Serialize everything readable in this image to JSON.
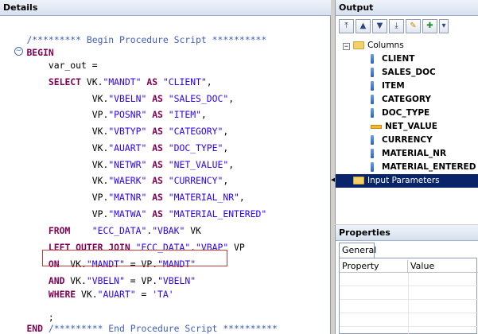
{
  "details": {
    "title": "Details",
    "code_lines": [
      [
        {
          "t": "    ",
          "c": "pl"
        },
        {
          "t": "/********* Begin Procedure Script **********",
          "c": "cm"
        }
      ],
      [
        {
          "t": "    ",
          "c": "pl"
        },
        {
          "t": "BEGIN",
          "c": "kw"
        }
      ],
      [
        {
          "t": "        var_out =",
          "c": "pl"
        }
      ],
      [
        {
          "t": "        ",
          "c": "pl"
        },
        {
          "t": "SELECT",
          "c": "kw"
        },
        {
          "t": " VK.",
          "c": "pl"
        },
        {
          "t": "\"MANDT\"",
          "c": "str"
        },
        {
          "t": " ",
          "c": "pl"
        },
        {
          "t": "AS",
          "c": "kw"
        },
        {
          "t": " ",
          "c": "pl"
        },
        {
          "t": "\"CLIENT\"",
          "c": "str"
        },
        {
          "t": ",",
          "c": "pl"
        }
      ],
      [
        {
          "t": "                VK.",
          "c": "pl"
        },
        {
          "t": "\"VBELN\"",
          "c": "str"
        },
        {
          "t": " ",
          "c": "pl"
        },
        {
          "t": "AS",
          "c": "kw"
        },
        {
          "t": " ",
          "c": "pl"
        },
        {
          "t": "\"SALES_DOC\"",
          "c": "str"
        },
        {
          "t": ",",
          "c": "pl"
        }
      ],
      [
        {
          "t": "                VP.",
          "c": "pl"
        },
        {
          "t": "\"POSNR\"",
          "c": "str"
        },
        {
          "t": " ",
          "c": "pl"
        },
        {
          "t": "AS",
          "c": "kw"
        },
        {
          "t": " ",
          "c": "pl"
        },
        {
          "t": "\"ITEM\"",
          "c": "str"
        },
        {
          "t": ",",
          "c": "pl"
        }
      ],
      [
        {
          "t": "                VK.",
          "c": "pl"
        },
        {
          "t": "\"VBTYP\"",
          "c": "str"
        },
        {
          "t": " ",
          "c": "pl"
        },
        {
          "t": "AS",
          "c": "kw"
        },
        {
          "t": " ",
          "c": "pl"
        },
        {
          "t": "\"CATEGORY\"",
          "c": "str"
        },
        {
          "t": ",",
          "c": "pl"
        }
      ],
      [
        {
          "t": "                VK.",
          "c": "pl"
        },
        {
          "t": "\"AUART\"",
          "c": "str"
        },
        {
          "t": " ",
          "c": "pl"
        },
        {
          "t": "AS",
          "c": "kw"
        },
        {
          "t": " ",
          "c": "pl"
        },
        {
          "t": "\"DOC_TYPE\"",
          "c": "str"
        },
        {
          "t": ",",
          "c": "pl"
        }
      ],
      [
        {
          "t": "                VK.",
          "c": "pl"
        },
        {
          "t": "\"NETWR\"",
          "c": "str"
        },
        {
          "t": " ",
          "c": "pl"
        },
        {
          "t": "AS",
          "c": "kw"
        },
        {
          "t": " ",
          "c": "pl"
        },
        {
          "t": "\"NET_VALUE\"",
          "c": "str"
        },
        {
          "t": ",",
          "c": "pl"
        }
      ],
      [
        {
          "t": "                VK.",
          "c": "pl"
        },
        {
          "t": "\"WAERK\"",
          "c": "str"
        },
        {
          "t": " ",
          "c": "pl"
        },
        {
          "t": "AS",
          "c": "kw"
        },
        {
          "t": " ",
          "c": "pl"
        },
        {
          "t": "\"CURRENCY\"",
          "c": "str"
        },
        {
          "t": ",",
          "c": "pl"
        }
      ],
      [
        {
          "t": "                VP.",
          "c": "pl"
        },
        {
          "t": "\"MATNR\"",
          "c": "str"
        },
        {
          "t": " ",
          "c": "pl"
        },
        {
          "t": "AS",
          "c": "kw"
        },
        {
          "t": " ",
          "c": "pl"
        },
        {
          "t": "\"MATERIAL_NR\"",
          "c": "str"
        },
        {
          "t": ",",
          "c": "pl"
        }
      ],
      [
        {
          "t": "                VP.",
          "c": "pl"
        },
        {
          "t": "\"MATWA\"",
          "c": "str"
        },
        {
          "t": " ",
          "c": "pl"
        },
        {
          "t": "AS",
          "c": "kw"
        },
        {
          "t": " ",
          "c": "pl"
        },
        {
          "t": "\"MATERIAL_ENTERED\"",
          "c": "str"
        }
      ],
      [
        {
          "t": "        ",
          "c": "pl"
        },
        {
          "t": "FROM",
          "c": "kw"
        },
        {
          "t": "    ",
          "c": "pl"
        },
        {
          "t": "\"ECC_DATA\"",
          "c": "str"
        },
        {
          "t": ".",
          "c": "pl"
        },
        {
          "t": "\"VBAK\"",
          "c": "str"
        },
        {
          "t": " VK",
          "c": "pl"
        }
      ],
      [
        {
          "t": "        ",
          "c": "pl"
        },
        {
          "t": "LEFT OUTER JOIN",
          "c": "kw"
        },
        {
          "t": " ",
          "c": "pl"
        },
        {
          "t": "\"ECC_DATA\"",
          "c": "str"
        },
        {
          "t": ".",
          "c": "pl"
        },
        {
          "t": "\"VBAP\"",
          "c": "str"
        },
        {
          "t": " VP",
          "c": "pl"
        }
      ],
      [
        {
          "t": "        ",
          "c": "pl"
        },
        {
          "t": "ON",
          "c": "kw"
        },
        {
          "t": "  VK.",
          "c": "pl"
        },
        {
          "t": "\"MANDT\"",
          "c": "str"
        },
        {
          "t": " = VP.",
          "c": "pl"
        },
        {
          "t": "\"MANDT\"",
          "c": "str"
        }
      ],
      [
        {
          "t": "        ",
          "c": "pl"
        },
        {
          "t": "AND",
          "c": "kw"
        },
        {
          "t": " VK.",
          "c": "pl"
        },
        {
          "t": "\"VBELN\"",
          "c": "str"
        },
        {
          "t": " = VP.",
          "c": "pl"
        },
        {
          "t": "\"VBELN\"",
          "c": "str"
        }
      ],
      [
        {
          "t": "        ",
          "c": "pl"
        },
        {
          "t": "WHERE",
          "c": "kw"
        },
        {
          "t": " VK.",
          "c": "pl"
        },
        {
          "t": "\"AUART\"",
          "c": "str"
        },
        {
          "t": " = ",
          "c": "pl"
        },
        {
          "t": "'TA'",
          "c": "str"
        }
      ],
      [
        {
          "t": "",
          "c": "pl"
        }
      ],
      [
        {
          "t": "        ;",
          "c": "pl"
        }
      ],
      [
        {
          "t": "",
          "c": "pl"
        }
      ],
      [
        {
          "t": "",
          "c": "pl"
        }
      ],
      [
        {
          "t": "    ",
          "c": "pl"
        },
        {
          "t": "END",
          "c": "kw"
        },
        {
          "t": " ",
          "c": "pl"
        },
        {
          "t": "/********* End Procedure Script **********",
          "c": "cm"
        }
      ]
    ]
  },
  "output": {
    "title": "Output",
    "toolbar": [
      "move-top-icon",
      "move-up-icon",
      "move-down-icon",
      "move-bottom-icon",
      "edit-icon",
      "add-icon",
      "dropdown-icon"
    ],
    "toolbar_glyphs": [
      "⤒",
      "▲",
      "▼",
      "⤓",
      "✎",
      "✚",
      "▾"
    ],
    "tree": {
      "columns_label": "Columns",
      "columns": [
        "CLIENT",
        "SALES_DOC",
        "ITEM",
        "CATEGORY",
        "DOC_TYPE",
        "NET_VALUE",
        "CURRENCY",
        "MATERIAL_NR",
        "MATERIAL_ENTERED"
      ],
      "measure_index": 5,
      "input_params_label": "Input Parameters"
    }
  },
  "properties": {
    "title": "Properties",
    "tab": "General",
    "col_property": "Property",
    "col_value": "Value"
  }
}
